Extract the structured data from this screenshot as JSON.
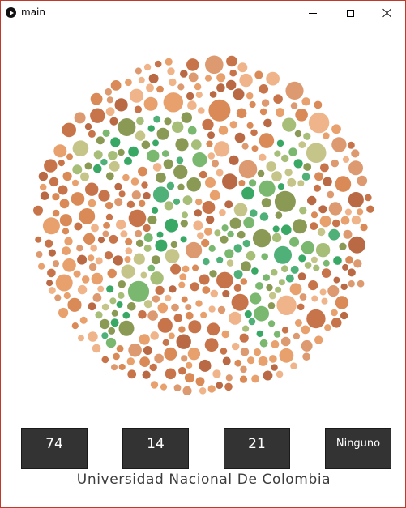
{
  "window": {
    "title": "main"
  },
  "plate": {
    "palette_background": [
      "#e8a06d",
      "#d98a56",
      "#c8744a",
      "#f0b48a",
      "#dd9a70",
      "#b96a45"
    ],
    "palette_figure": [
      "#3aa865",
      "#7ab870",
      "#a7be78",
      "#c5c58a",
      "#8a9a55",
      "#4fb078"
    ]
  },
  "answers": [
    {
      "label": "74"
    },
    {
      "label": "14"
    },
    {
      "label": "21"
    },
    {
      "label": "Ninguno"
    }
  ],
  "footer": {
    "text": "Universidad Nacional De Colombia"
  }
}
